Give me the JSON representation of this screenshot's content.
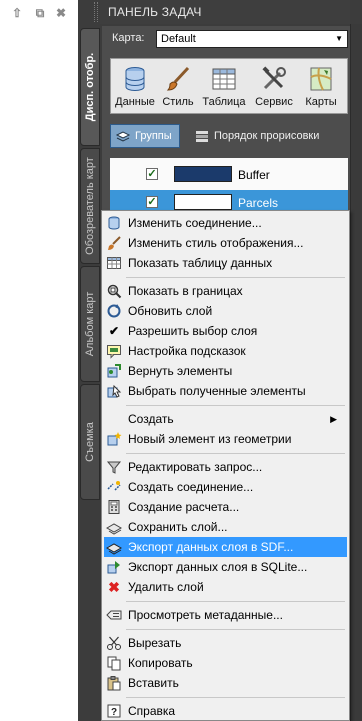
{
  "panel_title": "ПАНЕЛЬ ЗАДАЧ",
  "window_buttons": {
    "pin": "⇧",
    "restore": "⧉",
    "close": "✖"
  },
  "vtabs": [
    "Дисп. отобр.",
    "Обозреватель карт",
    "Альбом карт",
    "Съемка"
  ],
  "map": {
    "label": "Карта:",
    "value": "Default"
  },
  "toolbar": [
    "Данные",
    "Стиль",
    "Таблица",
    "Сервис",
    "Карты"
  ],
  "groups_label": "Группы",
  "draw_order_label": "Порядок прорисовки",
  "layers": [
    {
      "name": "Buffer",
      "color": "#1b3a6b"
    },
    {
      "name": "Parcels",
      "color": "#ffffff"
    }
  ],
  "menu": [
    {
      "label": "Изменить соединение...",
      "icon": "db-icon"
    },
    {
      "label": "Изменить стиль отображения...",
      "icon": "brush-icon"
    },
    {
      "label": "Показать таблицу данных",
      "icon": "table-icon"
    },
    {
      "label": "Показать в границах",
      "icon": "zoom-extents-icon"
    },
    {
      "label": "Обновить слой",
      "icon": "refresh-icon"
    },
    {
      "label": "Разрешить выбор слоя",
      "icon": "check-icon"
    },
    {
      "label": "Настройка подсказок",
      "icon": "tooltip-icon"
    },
    {
      "label": "Вернуть элементы",
      "icon": "return-icon"
    },
    {
      "label": "Выбрать полученные элементы",
      "icon": "select-icon"
    },
    {
      "label": "Создать",
      "icon": "",
      "submenu": "▶"
    },
    {
      "label": "Новый элемент из геометрии",
      "icon": "new-feature-icon"
    },
    {
      "label": "Редактировать запрос...",
      "icon": "filter-icon"
    },
    {
      "label": "Создать соединение...",
      "icon": "join-icon"
    },
    {
      "label": "Создание расчета...",
      "icon": "calculator-icon"
    },
    {
      "label": "Сохранить слой...",
      "icon": "save-layer-icon"
    },
    {
      "label": "Экспорт данных слоя в SDF...",
      "icon": "export-sdf-icon",
      "highlight": true
    },
    {
      "label": "Экспорт данных слоя в SQLite...",
      "icon": "export-sqlite-icon"
    },
    {
      "label": "Удалить слой",
      "icon": "delete-icon"
    },
    {
      "label": "Просмотреть метаданные...",
      "icon": "metadata-icon"
    },
    {
      "label": "Вырезать",
      "icon": "cut-icon"
    },
    {
      "label": "Копировать",
      "icon": "copy-icon"
    },
    {
      "label": "Вставить",
      "icon": "paste-icon"
    },
    {
      "label": "Справка",
      "icon": "help-icon"
    }
  ],
  "colors": {
    "highlight": "#3399ff",
    "selected_layer": "#3b96d9",
    "panel": "#4d4d4d"
  }
}
